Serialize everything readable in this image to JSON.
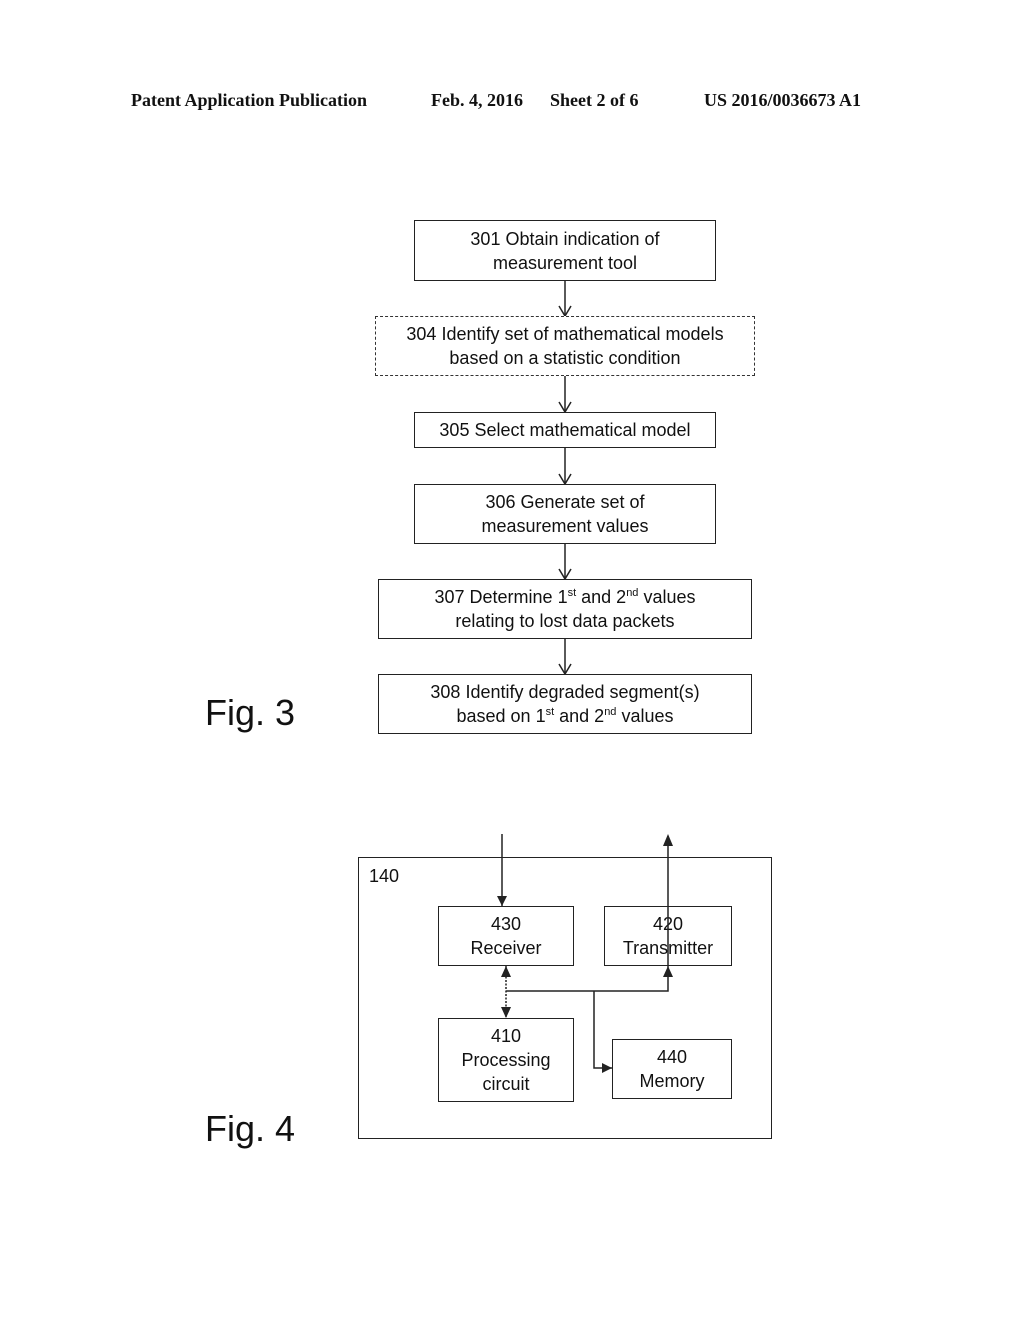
{
  "header": {
    "publication": "Patent Application Publication",
    "date": "Feb. 4, 2016",
    "sheet": "Sheet 2 of 6",
    "number": "US 2016/0036673 A1"
  },
  "fig3": {
    "label": "Fig. 3",
    "steps": [
      {
        "id": "301",
        "line1": "301 Obtain indication of",
        "line2": "measurement tool",
        "style": "solid"
      },
      {
        "id": "304",
        "line1": "304 Identify set of mathematical models",
        "line2": "based on a statistic condition",
        "style": "dashed"
      },
      {
        "id": "305",
        "line1": "305 Select mathematical model",
        "style": "solid"
      },
      {
        "id": "306",
        "line1": "306 Generate set of",
        "line2": "measurement values",
        "style": "solid"
      },
      {
        "id": "307",
        "l1a": "307 Determine 1",
        "l1sup1": "st",
        "l1b": " and 2",
        "l1sup2": "nd",
        "l1c": " values",
        "line2": "relating to lost data packets",
        "style": "solid"
      },
      {
        "id": "308",
        "line1": "308 Identify degraded segment(s)",
        "l2a": "based on 1",
        "l2sup1": "st",
        "l2b": " and 2",
        "l2sup2": "nd",
        "l2c": " values",
        "style": "solid"
      }
    ]
  },
  "fig4": {
    "label": "Fig. 4",
    "device": "140",
    "blocks": {
      "receiver": {
        "num": "430",
        "name": "Receiver"
      },
      "transmitter": {
        "num": "420",
        "name": "Transmitter"
      },
      "processing": {
        "num": "410",
        "line1": "Processing",
        "line2": "circuit"
      },
      "memory": {
        "num": "440",
        "name": "Memory"
      }
    }
  }
}
